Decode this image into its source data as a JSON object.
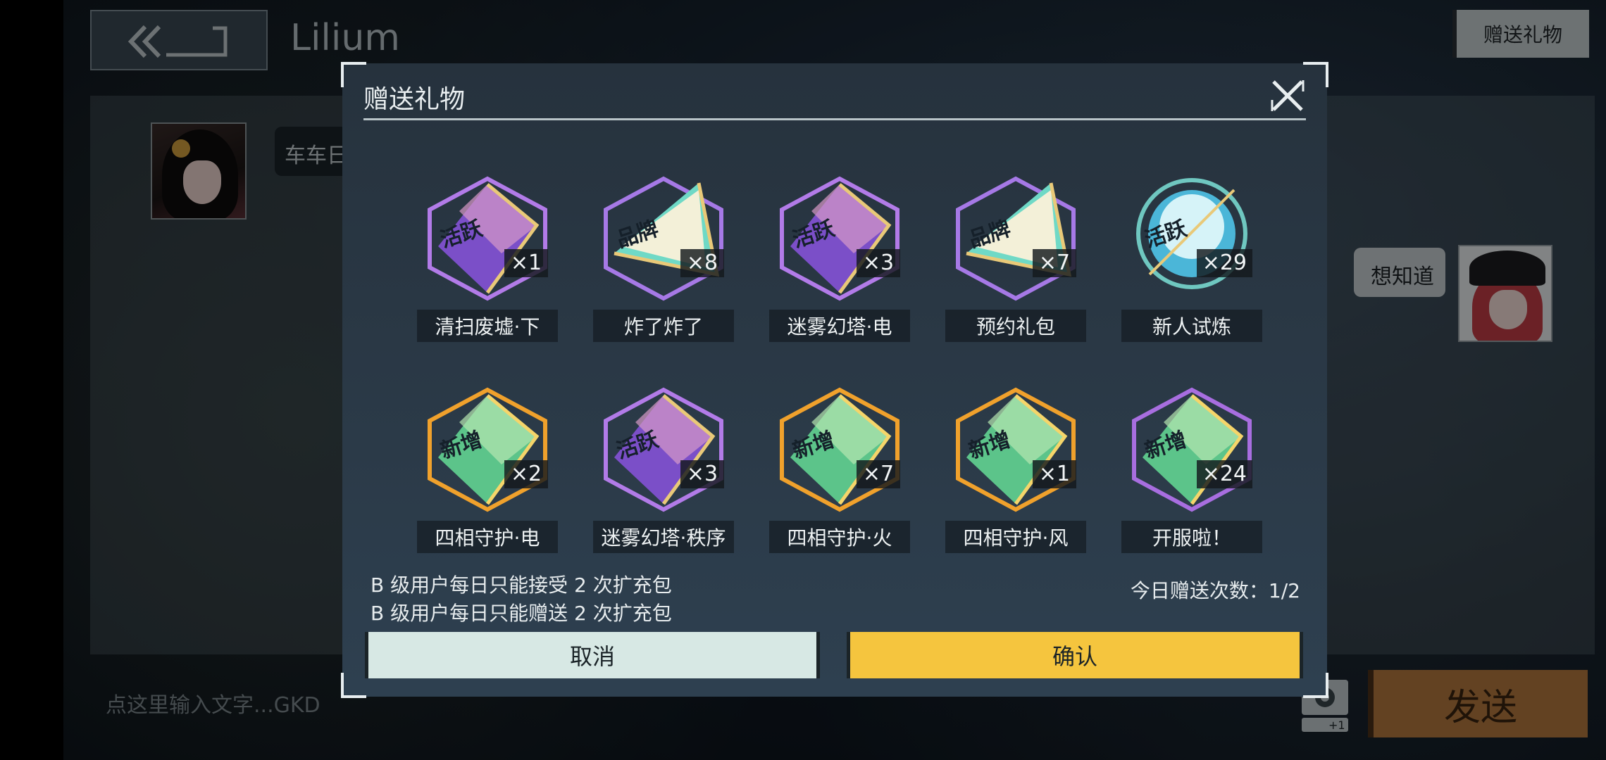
{
  "header": {
    "chat_title": "Lilium",
    "gift_button_label": "赠送礼物"
  },
  "chat": {
    "left_message": "车车日记",
    "right_message": "想知道"
  },
  "composer": {
    "placeholder": "点这里输入文字...GKD",
    "sticker_badge": "+1",
    "send_label": "发送"
  },
  "modal": {
    "title": "赠送礼物",
    "items": [
      {
        "name": "清扫废墟·下",
        "count": "×1",
        "tag": "活跃",
        "style": "purple-hex"
      },
      {
        "name": "炸了炸了",
        "count": "×8",
        "tag": "品牌",
        "style": "teal-tri"
      },
      {
        "name": "迷雾幻塔·电",
        "count": "×3",
        "tag": "活跃",
        "style": "purple-hex"
      },
      {
        "name": "预约礼包",
        "count": "×7",
        "tag": "品牌",
        "style": "teal-tri"
      },
      {
        "name": "新人试炼",
        "count": "×29",
        "tag": "活跃",
        "style": "cyan-coin"
      },
      {
        "name": "四相守护·电",
        "count": "×2",
        "tag": "新增",
        "style": "green-gold"
      },
      {
        "name": "迷雾幻塔·秩序",
        "count": "×3",
        "tag": "活跃",
        "style": "purple-hex"
      },
      {
        "name": "四相守护·火",
        "count": "×7",
        "tag": "新增",
        "style": "green-gold"
      },
      {
        "name": "四相守护·风",
        "count": "×1",
        "tag": "新增",
        "style": "green-gold"
      },
      {
        "name": "开服啦！",
        "count": "×24",
        "tag": "新增",
        "style": "green-purple"
      }
    ],
    "rule_receive": "B 级用户每日只能接受 2 次扩充包",
    "rule_send": "B 级用户每日只能赠送 2 次扩充包",
    "today_count": "今日赠送次数：1/2",
    "cancel_label": "取消",
    "confirm_label": "确认"
  },
  "colors": {
    "confirm": "#f5c53e",
    "cancel": "#d7e8e4",
    "send": "#b4793f"
  }
}
